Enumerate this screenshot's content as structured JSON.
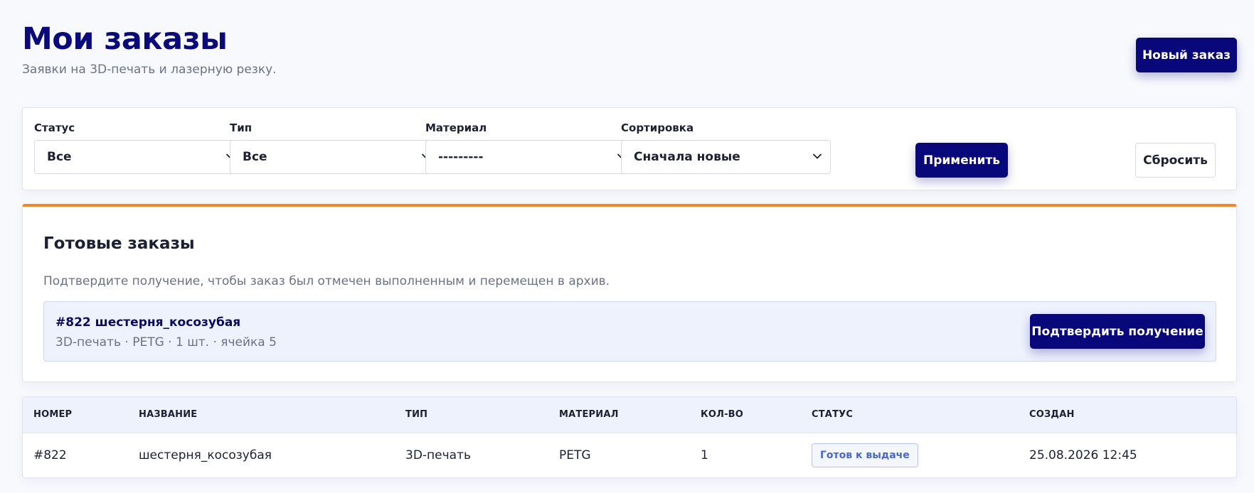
{
  "header": {
    "title": "Мои заказы",
    "subtitle": "Заявки на 3D-печать и лазерную резку.",
    "new_order_label": "Новый заказ"
  },
  "filters": {
    "status": {
      "label": "Статус",
      "value": "Все"
    },
    "type": {
      "label": "Тип",
      "value": "Все"
    },
    "material": {
      "label": "Материал",
      "value": "---------"
    },
    "sort": {
      "label": "Сортировка",
      "value": "Сначала новые"
    },
    "apply_label": "Применить",
    "reset_label": "Сбросить"
  },
  "ready": {
    "title": "Готовые заказы",
    "description": "Подтвердите получение, чтобы заказ был отмечен выполненным и перемещен в архив.",
    "item": {
      "title": "#822 шестерня_косозубая",
      "meta": "3D-печать · PETG · 1 шт. · ячейка 5",
      "confirm_label": "Подтвердить получение"
    }
  },
  "table": {
    "columns": [
      "Номер",
      "Название",
      "Тип",
      "Материал",
      "Кол-во",
      "Статус",
      "Создан"
    ],
    "rows": [
      {
        "number": "#822",
        "name": "шестерня_косозубая",
        "type": "3D-печать",
        "material": "PETG",
        "quantity": "1",
        "status": "Готов к выдаче",
        "created": "25.08.2026 12:45"
      }
    ]
  },
  "colors": {
    "primary": "#08087a",
    "accent_orange": "#f0882c",
    "badge_text": "#4a66c8"
  },
  "icons": {
    "select_arrow": "chevron-down-icon"
  }
}
